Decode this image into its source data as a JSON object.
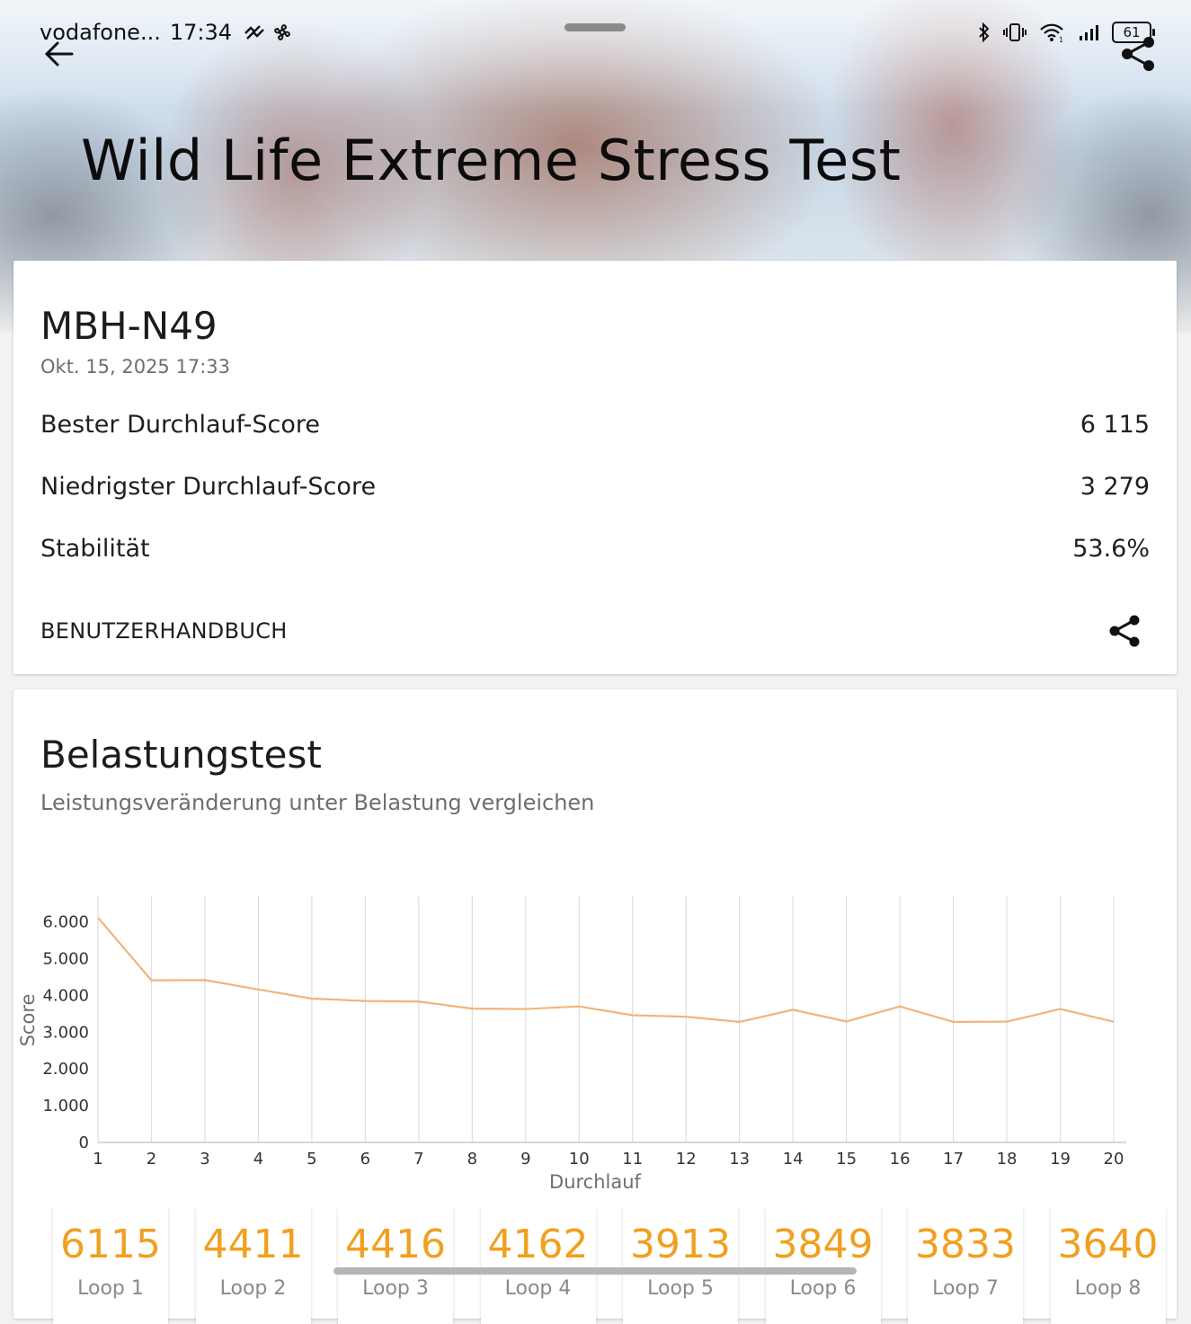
{
  "status_bar": {
    "carrier": "vodafone...",
    "time": "17:34",
    "battery": "61"
  },
  "header": {
    "title": "Wild Life Extreme Stress Test"
  },
  "summary": {
    "device": "MBH-N49",
    "date": "Okt. 15, 2025 17:33",
    "best_label": "Bester Durchlauf-Score",
    "best_value": "6 115",
    "lowest_label": "Niedrigster Durchlauf-Score",
    "lowest_value": "3 279",
    "stability_label": "Stabilität",
    "stability_value": "53.6%",
    "manual_link": "BENUTZERHANDBUCH"
  },
  "stress": {
    "title": "Belastungstest",
    "subtitle": "Leistungsveränderung unter Belastung vergleichen"
  },
  "chart_data": {
    "type": "line",
    "xlabel": "Durchlauf",
    "ylabel": "Score",
    "x": [
      1,
      2,
      3,
      4,
      5,
      6,
      7,
      8,
      9,
      10,
      11,
      12,
      13,
      14,
      15,
      16,
      17,
      18,
      19,
      20
    ],
    "values": [
      6115,
      4411,
      4416,
      4162,
      3913,
      3849,
      3833,
      3640,
      3630,
      3700,
      3460,
      3420,
      3279,
      3610,
      3290,
      3700,
      3280,
      3285,
      3630,
      3285
    ],
    "ylim": [
      0,
      6700
    ],
    "yticks": [
      0,
      1000,
      2000,
      3000,
      4000,
      5000,
      6000
    ],
    "ytick_labels": [
      "0",
      "1.000",
      "2.000",
      "3.000",
      "4.000",
      "5.000",
      "6.000"
    ],
    "grid": "vertical",
    "color": "#f2b47a"
  },
  "loops": [
    {
      "score": "6115",
      "label": "Loop 1"
    },
    {
      "score": "4411",
      "label": "Loop 2"
    },
    {
      "score": "4416",
      "label": "Loop 3"
    },
    {
      "score": "4162",
      "label": "Loop 4"
    },
    {
      "score": "3913",
      "label": "Loop 5"
    },
    {
      "score": "3849",
      "label": "Loop 6"
    },
    {
      "score": "3833",
      "label": "Loop 7"
    },
    {
      "score": "3640",
      "label": "Loop 8"
    }
  ],
  "colors": {
    "accent": "#f0a020",
    "line": "#f2b47a"
  }
}
